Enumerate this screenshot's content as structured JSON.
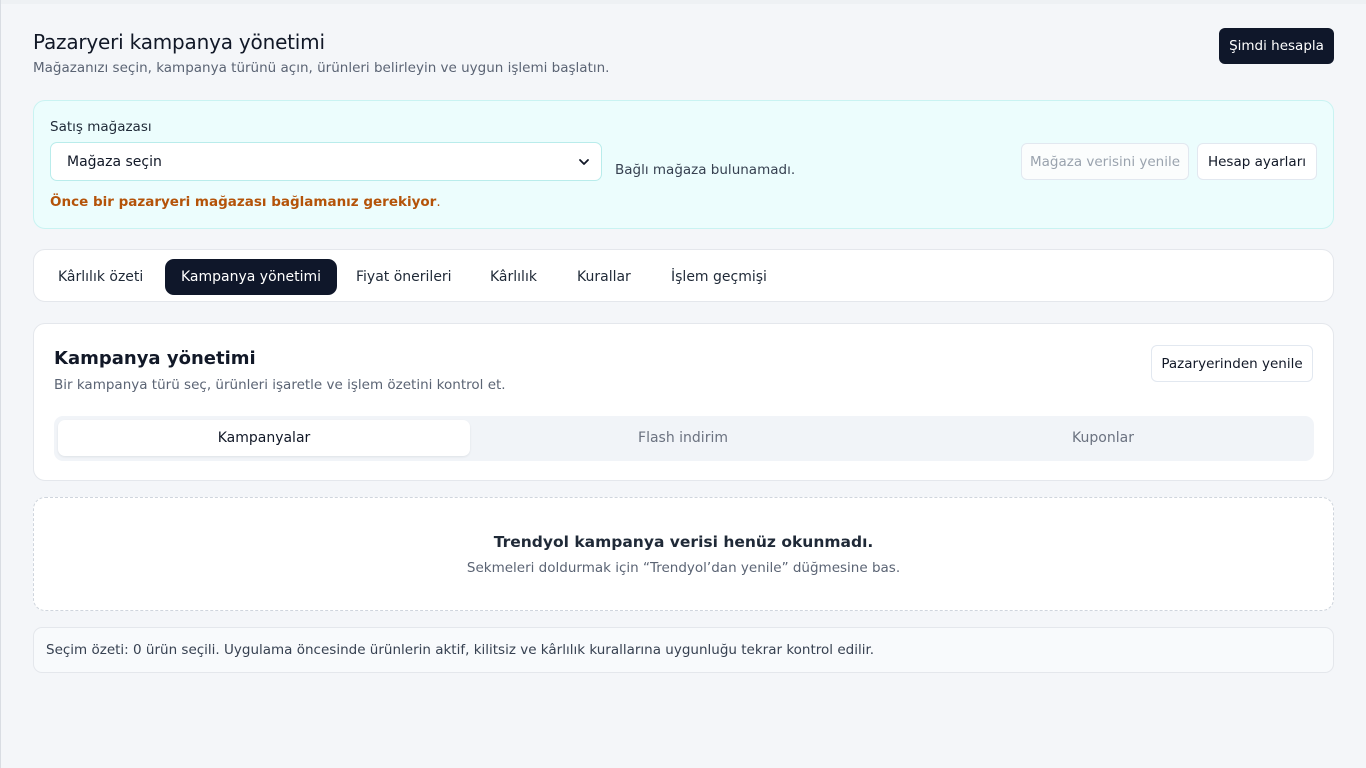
{
  "header": {
    "title": "Pazaryeri kampanya yönetimi",
    "subtitle": "Mağazanızı seçin, kampanya türünü açın, ürünleri belirleyin ve uygun işlemi başlatın.",
    "calculate_button": "Şimdi hesapla"
  },
  "store": {
    "label": "Satış mağazası",
    "select_value": "Mağaza seçin",
    "status": "Bağlı mağaza bulunamadı.",
    "warning": "Önce bir pazaryeri mağazası bağlamanız gerekiyor",
    "warning_dot": ".",
    "refresh_button": "Mağaza verisini yenile",
    "settings_button": "Hesap ayarları"
  },
  "tabs": [
    {
      "label": "Kârlılık özeti",
      "active": false
    },
    {
      "label": "Kampanya yönetimi",
      "active": true
    },
    {
      "label": "Fiyat önerileri",
      "active": false
    },
    {
      "label": "Kârlılık",
      "active": false
    },
    {
      "label": "Kurallar",
      "active": false
    },
    {
      "label": "İşlem geçmişi",
      "active": false
    }
  ],
  "campaign": {
    "title": "Kampanya yönetimi",
    "subtitle": "Bir kampanya türü seç, ürünleri işaretle ve işlem özetini kontrol et.",
    "refresh_button": "Pazaryerinden yenile",
    "segments": [
      {
        "label": "Kampanyalar",
        "active": true
      },
      {
        "label": "Flash indirim",
        "active": false
      },
      {
        "label": "Kuponlar",
        "active": false
      }
    ]
  },
  "empty_state": {
    "title": "Trendyol kampanya verisi henüz okunmadı.",
    "subtitle": "Sekmeleri doldurmak için “Trendyol’dan yenile” düğmesine bas."
  },
  "summary": {
    "text": "Seçim özeti: 0 ürün seçili. Uygulama öncesinde ürünlerin aktif, kilitsiz ve kârlılık kurallarına uygunluğu tekrar kontrol edilir."
  },
  "colors": {
    "primary_dark": "#0f172a",
    "store_panel_bg": "#ecfdfd",
    "warning": "#b45309",
    "page_bg": "#f4f6f9"
  }
}
